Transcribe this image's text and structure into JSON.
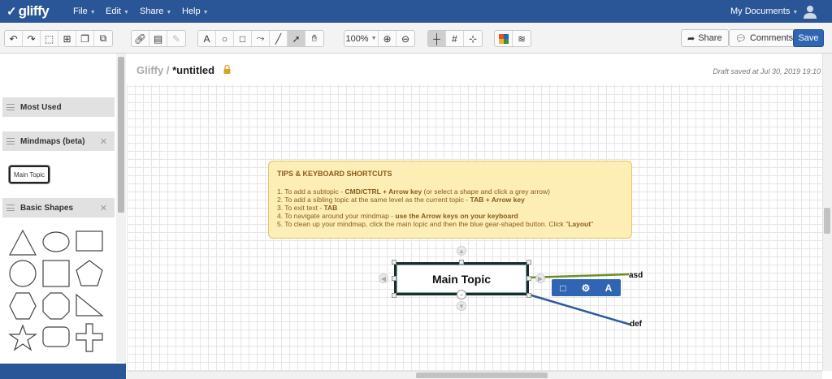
{
  "app": {
    "logo_text": "gliffy"
  },
  "menu": [
    {
      "label": "File"
    },
    {
      "label": "Edit"
    },
    {
      "label": "Share"
    },
    {
      "label": "Help"
    }
  ],
  "account": {
    "my_documents_label": "My Documents"
  },
  "toolbar": {
    "zoom_value": "100%",
    "share_label": "Share",
    "comments_label": "Comments",
    "save_label": "Save",
    "text_tool_glyph": "A"
  },
  "library": {
    "categories": [
      {
        "label": "Most Used",
        "closable": false
      },
      {
        "label": "Mindmaps (beta)",
        "closable": true
      },
      {
        "label": "Basic Shapes",
        "closable": true
      }
    ],
    "mindmap_swatch_label": "Main Topic",
    "basic_shapes": [
      "triangle",
      "ellipse",
      "rectangle",
      "circle",
      "square",
      "pentagon",
      "hexagon",
      "octagon",
      "right-triangle",
      "star",
      "rounded-rectangle",
      "cross"
    ]
  },
  "document": {
    "root_label": "Gliffy",
    "separator": "/",
    "title": "*untitled",
    "draft_status": "Draft saved at Jul 30, 2019 19:10"
  },
  "tips": {
    "title": "TIPS & KEYBOARD SHORTCUTS",
    "lines": [
      {
        "prefix": "1. To add a subtopic - ",
        "bold": "CMD/CTRL + Arrow key",
        "suffix": " (or select a shape and click a grey arrow)"
      },
      {
        "prefix": "2. To add a sibling topic at the same level as the current topic - ",
        "bold": "TAB + Arrow key",
        "suffix": ""
      },
      {
        "prefix": "3. To exit text  - ",
        "bold": "TAB",
        "suffix": ""
      },
      {
        "prefix": "4. To navigate around your mindmap - ",
        "bold": "use the Arrow keys on your keyboard",
        "suffix": ""
      },
      {
        "prefix": "5. To clean up your mindmap, click the main topic and then the blue gear-shaped button.  Click \"",
        "bold": "Layout",
        "suffix": "\""
      }
    ]
  },
  "mindmap": {
    "main_topic": "Main Topic",
    "subtopics": [
      {
        "label": "asd",
        "color": "#6b8e23"
      },
      {
        "label": "def",
        "color": "#2f5a9e"
      }
    ]
  },
  "floating_toolbar": {
    "text_glyph": "A"
  },
  "colors": {
    "brand_blue": "#2a5597",
    "save_blue": "#2f65b2",
    "tips_bg": "#fdeeb5"
  }
}
